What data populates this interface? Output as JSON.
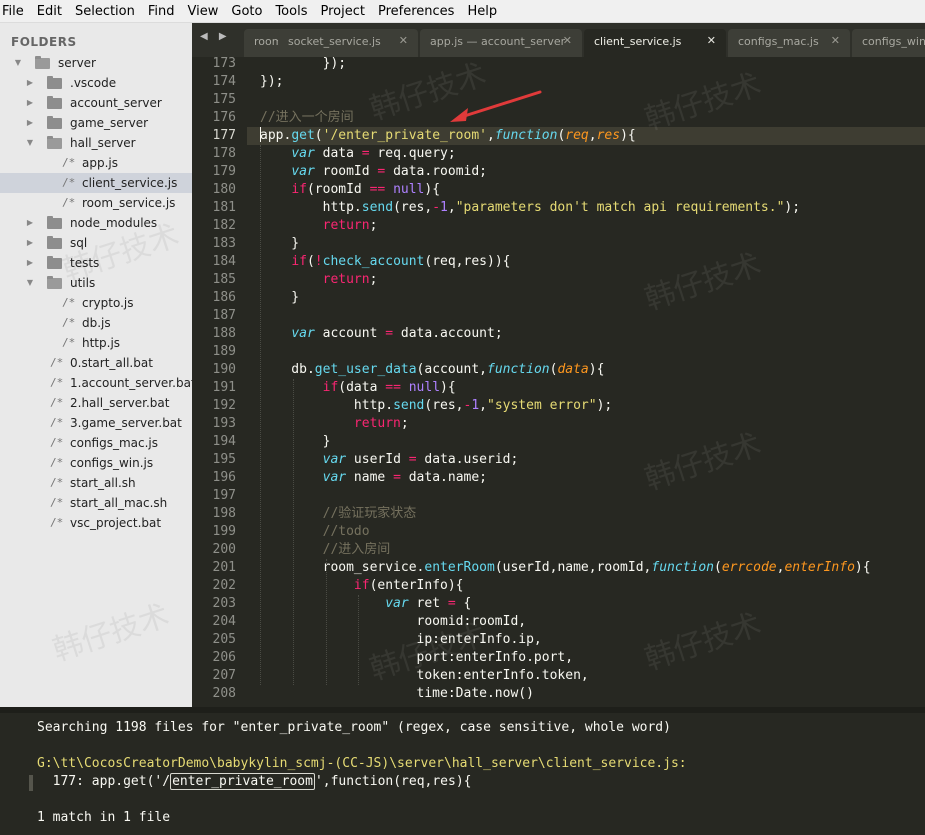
{
  "menu": [
    "File",
    "Edit",
    "Selection",
    "Find",
    "View",
    "Goto",
    "Tools",
    "Project",
    "Preferences",
    "Help"
  ],
  "sidebar": {
    "title": "FOLDERS",
    "tree": [
      {
        "label": "server",
        "type": "folder",
        "open": true,
        "depth": 0
      },
      {
        "label": ".vscode",
        "type": "folder",
        "open": false,
        "depth": 1
      },
      {
        "label": "account_server",
        "type": "folder",
        "open": false,
        "depth": 1
      },
      {
        "label": "game_server",
        "type": "folder",
        "open": false,
        "depth": 1
      },
      {
        "label": "hall_server",
        "type": "folder",
        "open": true,
        "depth": 1
      },
      {
        "label": "app.js",
        "type": "file",
        "depth": 2
      },
      {
        "label": "client_service.js",
        "type": "file",
        "depth": 2,
        "selected": true
      },
      {
        "label": "room_service.js",
        "type": "file",
        "depth": 2
      },
      {
        "label": "node_modules",
        "type": "folder",
        "open": false,
        "depth": 1
      },
      {
        "label": "sql",
        "type": "folder",
        "open": false,
        "depth": 1
      },
      {
        "label": "tests",
        "type": "folder",
        "open": false,
        "depth": 1
      },
      {
        "label": "utils",
        "type": "folder",
        "open": true,
        "depth": 1
      },
      {
        "label": "crypto.js",
        "type": "file",
        "depth": 2
      },
      {
        "label": "db.js",
        "type": "file",
        "depth": 2
      },
      {
        "label": "http.js",
        "type": "file",
        "depth": 2
      },
      {
        "label": "0.start_all.bat",
        "type": "file",
        "depth": 1
      },
      {
        "label": "1.account_server.bat",
        "type": "file",
        "depth": 1
      },
      {
        "label": "2.hall_server.bat",
        "type": "file",
        "depth": 1
      },
      {
        "label": "3.game_server.bat",
        "type": "file",
        "depth": 1
      },
      {
        "label": "configs_mac.js",
        "type": "file",
        "depth": 1
      },
      {
        "label": "configs_win.js",
        "type": "file",
        "depth": 1
      },
      {
        "label": "start_all.sh",
        "type": "file",
        "depth": 1
      },
      {
        "label": "start_all_mac.sh",
        "type": "file",
        "depth": 1
      },
      {
        "label": "vsc_project.bat",
        "type": "file",
        "depth": 1
      }
    ]
  },
  "tabs": {
    "nav": "◀ ▶",
    "items": [
      {
        "label": "room",
        "close": "",
        "active": false
      },
      {
        "label": "socket_service.js",
        "close": "✕",
        "active": false
      },
      {
        "label": "app.js — account_server",
        "close": "✕",
        "active": false
      },
      {
        "label": "client_service.js",
        "close": "✕",
        "active": true
      },
      {
        "label": "configs_mac.js",
        "close": "✕",
        "active": false
      },
      {
        "label": "configs_win",
        "close": "",
        "active": false
      }
    ]
  },
  "editor": {
    "current_line": 177,
    "lines": [
      {
        "n": 173,
        "html": "        });"
      },
      {
        "n": 174,
        "html": "});"
      },
      {
        "n": 175,
        "html": ""
      },
      {
        "n": 176,
        "html": "<span class='cm'>//进入一个房间</span>"
      },
      {
        "n": 177,
        "html": "<span class='cursor'></span>app.<span class='fn'>get</span>(<span class='str'>'/enter_private_room'</span>,<span class='st'>function</span>(<span class='prm'>req</span>,<span class='prm'>res</span>){"
      },
      {
        "n": 178,
        "html": "    <span class='st'>var</span> data <span class='kw'>=</span> req.query;"
      },
      {
        "n": 179,
        "html": "    <span class='st'>var</span> roomId <span class='kw'>=</span> data.roomid;"
      },
      {
        "n": 180,
        "html": "    <span class='kw'>if</span>(roomId <span class='kw'>==</span> <span class='num'>null</span>){"
      },
      {
        "n": 181,
        "html": "        http.<span class='fn'>send</span>(res,<span class='kw'>-</span><span class='num'>1</span>,<span class='str'>\"parameters don't match api requirements.\"</span>);"
      },
      {
        "n": 182,
        "html": "        <span class='kw'>return</span>;"
      },
      {
        "n": 183,
        "html": "    }"
      },
      {
        "n": 184,
        "html": "    <span class='kw'>if</span>(<span class='kw'>!</span><span class='fn'>check_account</span>(req,res)){"
      },
      {
        "n": 185,
        "html": "        <span class='kw'>return</span>;"
      },
      {
        "n": 186,
        "html": "    }"
      },
      {
        "n": 187,
        "html": ""
      },
      {
        "n": 188,
        "html": "    <span class='st'>var</span> account <span class='kw'>=</span> data.account;"
      },
      {
        "n": 189,
        "html": ""
      },
      {
        "n": 190,
        "html": "    db.<span class='fn'>get_user_data</span>(account,<span class='st'>function</span>(<span class='prm'>data</span>){"
      },
      {
        "n": 191,
        "html": "        <span class='kw'>if</span>(data <span class='kw'>==</span> <span class='num'>null</span>){"
      },
      {
        "n": 192,
        "html": "            http.<span class='fn'>send</span>(res,<span class='kw'>-</span><span class='num'>1</span>,<span class='str'>\"system error\"</span>);"
      },
      {
        "n": 193,
        "html": "            <span class='kw'>return</span>;"
      },
      {
        "n": 194,
        "html": "        }"
      },
      {
        "n": 195,
        "html": "        <span class='st'>var</span> userId <span class='kw'>=</span> data.userid;"
      },
      {
        "n": 196,
        "html": "        <span class='st'>var</span> name <span class='kw'>=</span> data.name;"
      },
      {
        "n": 197,
        "html": ""
      },
      {
        "n": 198,
        "html": "        <span class='cm'>//验证玩家状态</span>"
      },
      {
        "n": 199,
        "html": "        <span class='cm'>//todo</span>"
      },
      {
        "n": 200,
        "html": "        <span class='cm'>//进入房间</span>"
      },
      {
        "n": 201,
        "html": "        room_service.<span class='fn'>enterRoom</span>(userId,name,roomId,<span class='st'>function</span>(<span class='prm'>errcode</span>,<span class='prm'>enterInfo</span>){"
      },
      {
        "n": 202,
        "html": "            <span class='kw'>if</span>(enterInfo){"
      },
      {
        "n": 203,
        "html": "                <span class='st'>var</span> ret <span class='kw'>=</span> {"
      },
      {
        "n": 204,
        "html": "                    roomid:roomId,"
      },
      {
        "n": 205,
        "html": "                    ip:enterInfo.ip,"
      },
      {
        "n": 206,
        "html": "                    port:enterInfo.port,"
      },
      {
        "n": 207,
        "html": "                    token:enterInfo.token,"
      },
      {
        "n": 208,
        "html": "                    time:Date.now()"
      }
    ]
  },
  "watermark": "韩仔技术",
  "results": {
    "summary": "Searching 1198 files for \"enter_private_room\" (regex, case sensitive, whole word)",
    "path": "G:\\tt\\CocosCreatorDemo\\babykylin_scmj-(CC-JS)\\server\\hall_server\\client_service.js:",
    "match_prefix": "  177: app.get('/",
    "match_term": "enter_private_room",
    "match_suffix": "',function(req,res){",
    "count": "1 match in 1 file"
  },
  "colors": {
    "background": "#272822",
    "sidebar": "#e9e9e9",
    "keyword": "#f92672",
    "string": "#e6db74",
    "comment": "#75715e",
    "param": "#fd971f",
    "number": "#ae81ff",
    "storage": "#66d9ef",
    "arrow": "#e03a3a"
  }
}
